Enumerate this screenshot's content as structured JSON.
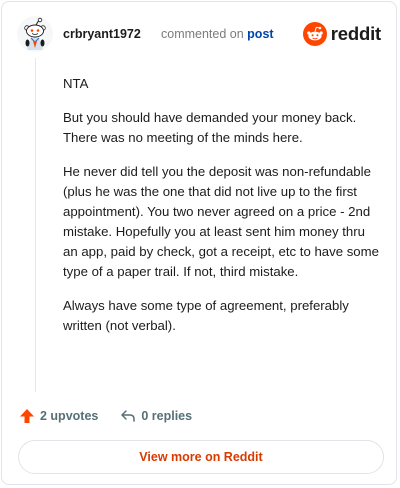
{
  "header": {
    "username": "crbryant1972",
    "action_text": "commented on",
    "post_link": "post",
    "brand_name": "reddit"
  },
  "comment": {
    "paragraphs": [
      "NTA",
      "But you should have demanded your money back. There was no meeting of the minds here.",
      "He never did tell you the deposit was non-refundable (plus he was the one that did not live up to the first appointment). You two never agreed on a price - 2nd mistake. Hopefully you at least sent him money thru an app, paid by check, got a receipt, etc to have some type of a paper trail. If not, third mistake.",
      "Always have some type of agreement, preferably written (not verbal)."
    ]
  },
  "actions": {
    "upvotes_label": "2 upvotes",
    "replies_label": "0 replies"
  },
  "footer": {
    "view_more_label": "View more on Reddit"
  },
  "icons": {
    "avatar": "snoo-avatar-icon",
    "brand": "reddit-logo-icon",
    "upvote": "upvote-arrow-icon",
    "reply": "reply-arrow-icon"
  },
  "colors": {
    "brand_orange": "#ff4500",
    "link_blue": "#0045ac",
    "view_more_text": "#d93a00",
    "muted_text": "#576f76"
  }
}
